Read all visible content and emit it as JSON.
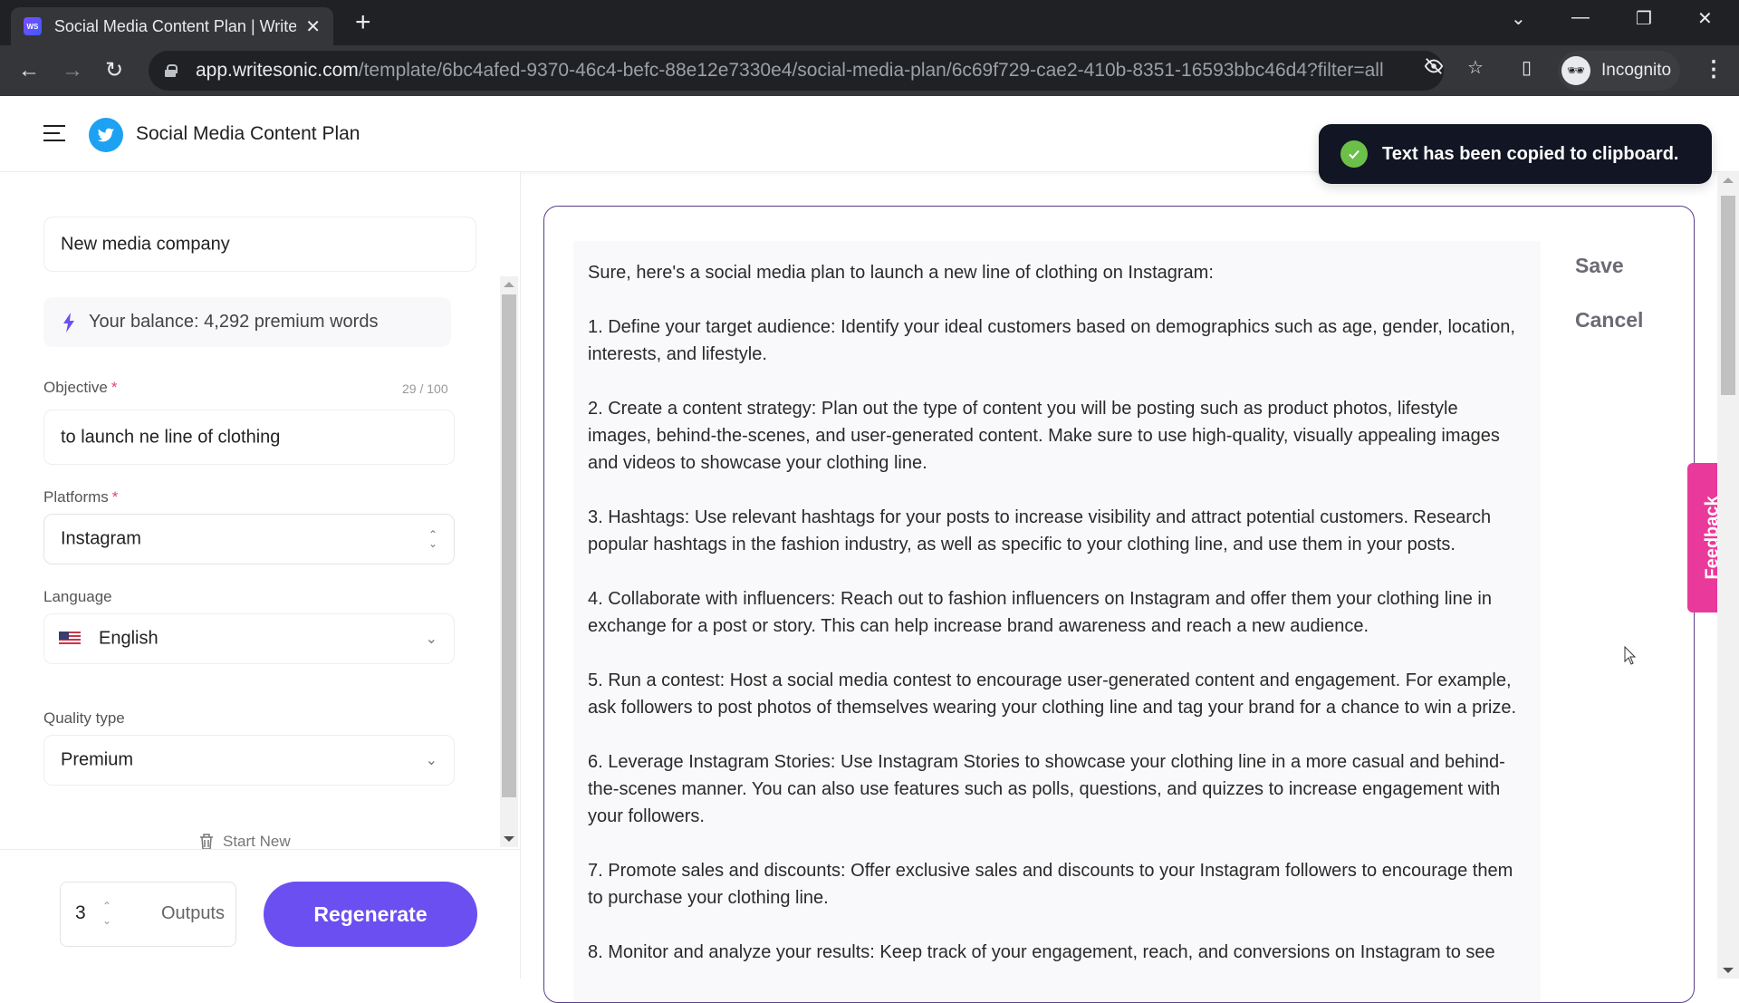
{
  "browser": {
    "tab_title": "Social Media Content Plan | Writesonic",
    "favicon_text": "WS",
    "url_host": "app.writesonic.com",
    "url_path": "/template/6bc4afed-9370-46c4-befc-88e12e7330e4/social-media-plan/6c69f729-cae2-410b-8351-16593bbc46d4?filter=all",
    "profile_label": "Incognito"
  },
  "header": {
    "title": "Social Media Content Plan",
    "brand_color": "#1da1f2"
  },
  "form": {
    "company_value": "New media company",
    "balance_text": "Your balance: 4,292 premium words",
    "objective": {
      "label": "Objective",
      "required_mark": "*",
      "counter": "29 / 100",
      "value": "to launch ne line of clothing"
    },
    "platforms": {
      "label": "Platforms",
      "required_mark": "*",
      "value": "Instagram"
    },
    "language": {
      "label": "Language",
      "value": "English",
      "flag": "us-flag"
    },
    "quality": {
      "label": "Quality type",
      "value": "Premium"
    },
    "start_new_label": "Start New",
    "outputs": {
      "value": "3",
      "label": "Outputs"
    },
    "regenerate_label": "Regenerate",
    "accent_color": "#6c4ff0"
  },
  "output": {
    "paragraphs": [
      "Sure, here's a social media plan to launch a new line of clothing on Instagram:",
      "1. Define your target audience: Identify your ideal customers based on demographics such as age, gender, location, interests, and lifestyle.",
      "2. Create a content strategy: Plan out the type of content you will be posting such as product photos, lifestyle images, behind-the-scenes, and user-generated content. Make sure to use high-quality, visually appealing images and videos to showcase your clothing line.",
      "3. Hashtags: Use relevant hashtags for your posts to increase visibility and attract potential customers. Research popular hashtags in the fashion industry, as well as specific to your clothing line, and use them in your posts.",
      "4. Collaborate with influencers: Reach out to fashion influencers on Instagram and offer them your clothing line in exchange for a post or story. This can help increase brand awareness and reach a new audience.",
      "5. Run a contest: Host a social media contest to encourage user-generated content and engagement. For example, ask followers to post photos of themselves wearing your clothing line and tag your brand for a chance to win a prize.",
      "6. Leverage Instagram Stories: Use Instagram Stories to showcase your clothing line in a more casual and behind-the-scenes manner. You can also use features such as polls, questions, and quizzes to increase engagement with your followers.",
      "7. Promote sales and discounts: Offer exclusive sales and discounts to your Instagram followers to encourage them to purchase your clothing line.",
      "8. Monitor and analyze your results: Keep track of your engagement, reach, and conversions on Instagram to see"
    ],
    "save_label": "Save",
    "cancel_label": "Cancel"
  },
  "toast": {
    "message": "Text has been copied to clipboard.",
    "status_color": "#6cc04a"
  },
  "feedback": {
    "label": "Feedback",
    "color": "#e9399a"
  }
}
